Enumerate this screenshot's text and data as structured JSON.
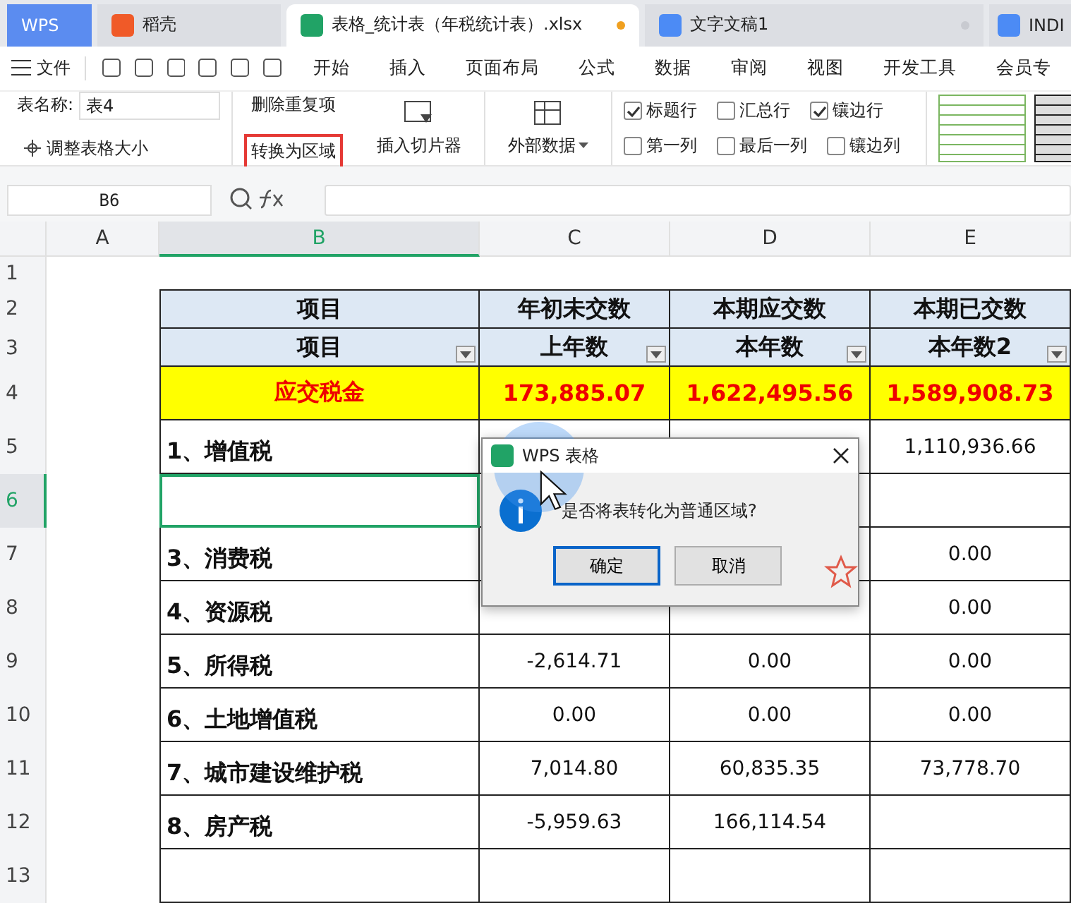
{
  "tabs": [
    {
      "kind": "home",
      "label": "WPS",
      "selected": false
    },
    {
      "kind": "docer",
      "label": "稻壳",
      "selected": false
    },
    {
      "kind": "sheet",
      "label": "表格_统计表（年税统计表）.xlsx",
      "selected": true,
      "unsaved": true
    },
    {
      "kind": "writer",
      "label": "文字文稿1",
      "selected": false,
      "unsaved": false
    },
    {
      "kind": "writer",
      "label": "INDI",
      "selected": false
    }
  ],
  "menu": {
    "file": "文件",
    "items": [
      "开始",
      "插入",
      "页面布局",
      "公式",
      "数据",
      "审阅",
      "视图",
      "开发工具",
      "会员专"
    ]
  },
  "ribbon": {
    "table_name_label": "表名称:",
    "table_name": "表4",
    "resize": "调整表格大小",
    "remove_duplicates": "删除重复项",
    "convert_to_range": {
      "label": "转换为区域",
      "highlighted": true
    },
    "slicer": "插入切片器",
    "external_data": "外部数据",
    "options": [
      {
        "label": "标题行",
        "checked": true
      },
      {
        "label": "汇总行",
        "checked": false
      },
      {
        "label": "镶边行",
        "checked": true
      },
      {
        "label": "第一列",
        "checked": false
      },
      {
        "label": "最后一列",
        "checked": false
      },
      {
        "label": "镶边列",
        "checked": false
      }
    ]
  },
  "formula_bar": {
    "cell": "B6"
  },
  "columns": [
    {
      "label": "A",
      "selected": false
    },
    {
      "label": "B",
      "selected": true
    },
    {
      "label": "C",
      "selected": false
    },
    {
      "label": "D",
      "selected": false
    },
    {
      "label": "E",
      "selected": false
    }
  ],
  "rows": [
    {
      "number": "1",
      "kind": "blank",
      "selected": false,
      "cells": []
    },
    {
      "number": "2",
      "kind": "header",
      "selected": false,
      "cells": [
        "项目",
        "年初未交数",
        "本期应交数",
        "本期已交数"
      ]
    },
    {
      "number": "3",
      "kind": "header",
      "selected": false,
      "filters": true,
      "cells": [
        "项目",
        "上年数",
        "本年数",
        "本年数2"
      ]
    },
    {
      "number": "4",
      "kind": "total",
      "selected": false,
      "cells": [
        "应交税金",
        "173,885.07",
        "1,622,495.56",
        "1,589,908.73"
      ]
    },
    {
      "number": "5",
      "kind": "item",
      "selected": false,
      "cells": [
        "1、增值税",
        "",
        "",
        "1,110,936.66"
      ]
    },
    {
      "number": "6",
      "kind": "item",
      "selected": true,
      "cells": []
    },
    {
      "number": "7",
      "kind": "item",
      "selected": false,
      "cells": [
        "3、消费税",
        "",
        "",
        "0.00"
      ]
    },
    {
      "number": "8",
      "kind": "item",
      "selected": false,
      "cells": [
        "4、资源税",
        "",
        "",
        "0.00"
      ]
    },
    {
      "number": "9",
      "kind": "item",
      "selected": false,
      "cells": [
        "5、所得税",
        "-2,614.71",
        "0.00",
        "0.00"
      ]
    },
    {
      "number": "10",
      "kind": "item",
      "selected": false,
      "cells": [
        "6、土地增值税",
        "0.00",
        "0.00",
        "0.00"
      ]
    },
    {
      "number": "11",
      "kind": "item",
      "selected": false,
      "cells": [
        "7、城市建设维护税",
        "7,014.80",
        "60,835.35",
        "73,778.70"
      ]
    },
    {
      "number": "12",
      "kind": "item",
      "selected": false,
      "cells": [
        "8、房产税",
        "-5,959.63",
        "166,114.54"
      ]
    },
    {
      "number": "13",
      "kind": "item",
      "selected": false,
      "cells": []
    }
  ],
  "dialog": {
    "title": "WPS 表格",
    "message": "是否将表转化为普通区域?",
    "buttons": [
      {
        "label": "确定",
        "selected": true
      },
      {
        "label": "取消",
        "selected": false
      }
    ]
  }
}
